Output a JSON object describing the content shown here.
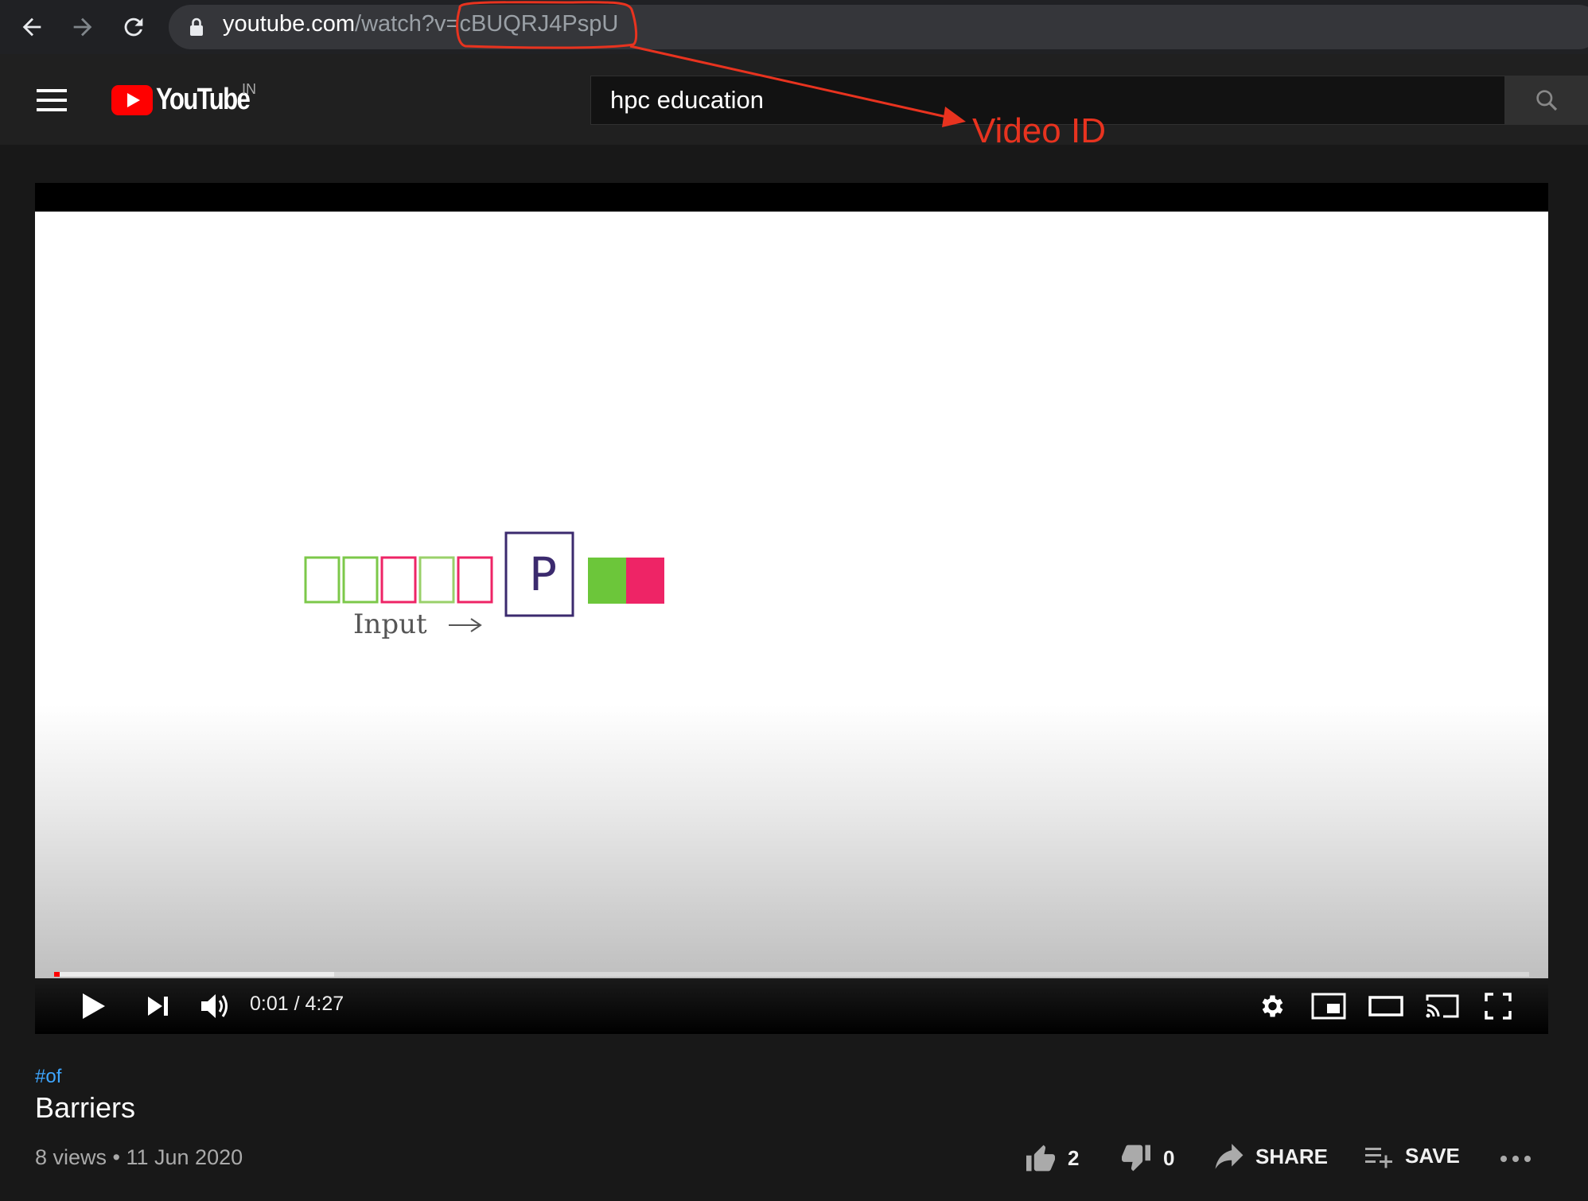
{
  "browser": {
    "url_domain": "youtube.com",
    "url_path": "/watch?v=",
    "url_video_id": "cBUQRJ4PspU"
  },
  "youtube": {
    "logo_text": "YouTube",
    "region": "IN",
    "search_value": "hpc education"
  },
  "annotation": {
    "label": "Video ID",
    "color": "#e8331f"
  },
  "player": {
    "time_current": "0:01",
    "time_separator": " / ",
    "time_total": "4:27",
    "progress_fraction": 0.004,
    "buffered_fraction": 0.19
  },
  "video_content": {
    "processor_label": "P",
    "input_label": "Input",
    "colors": {
      "green": "#6cc63a",
      "pink": "#ee2466",
      "outline_dark": "#3b2a6e"
    }
  },
  "video": {
    "hashtag": "#of",
    "title": "Barriers",
    "meta": "8 views • 11 Jun 2020",
    "likes": "2",
    "dislikes": "0",
    "share_label": "SHARE",
    "save_label": "SAVE"
  },
  "theme": {
    "accent": "#ff0000",
    "link": "#3ea6ff"
  }
}
